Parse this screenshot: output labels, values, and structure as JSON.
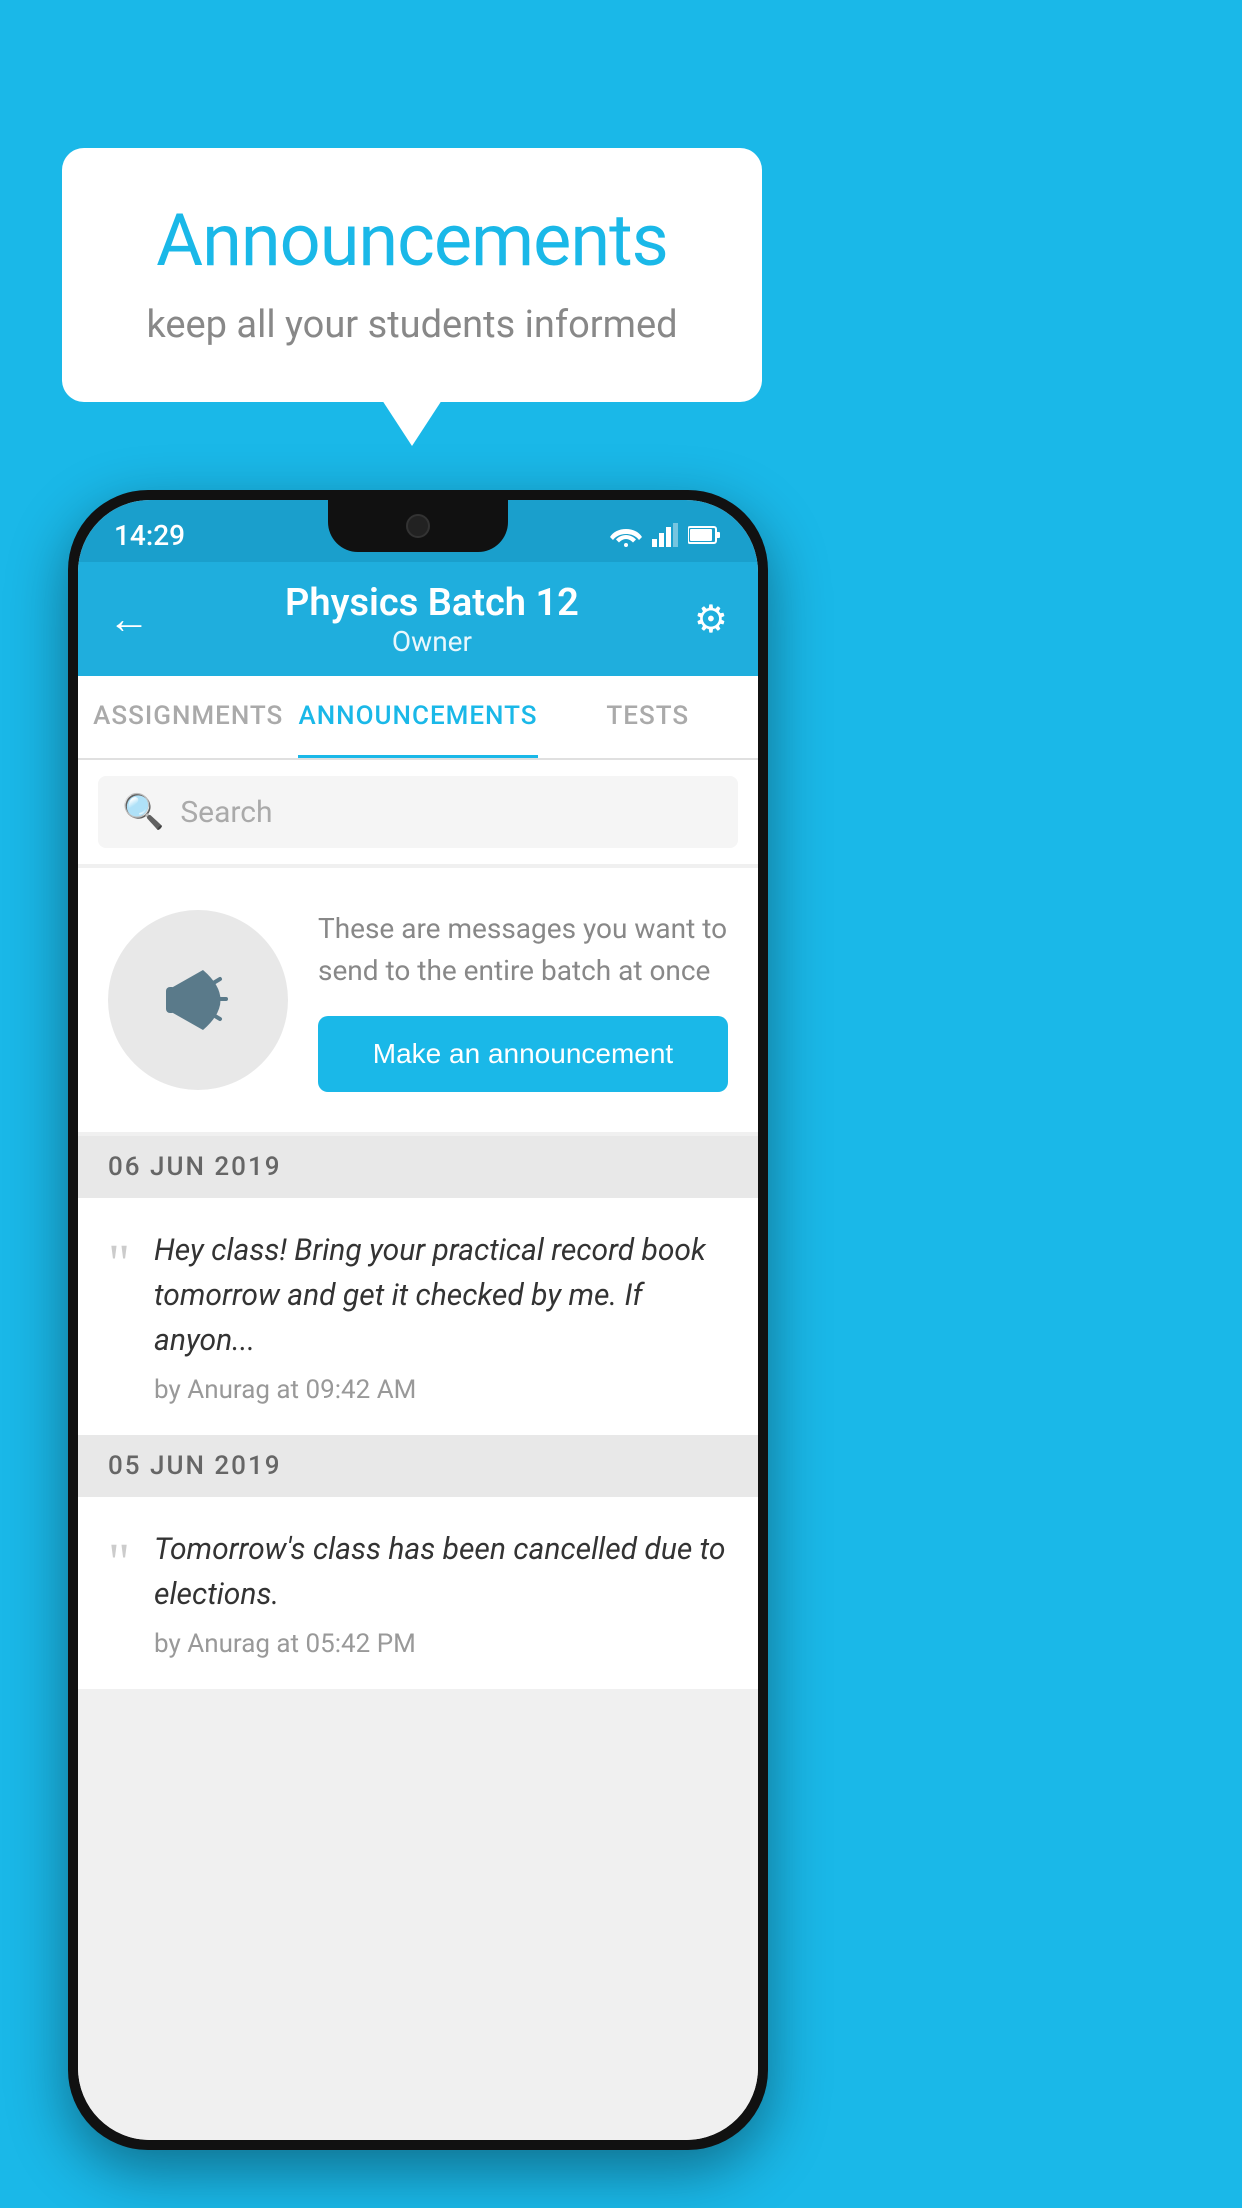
{
  "background_color": "#1ab8e8",
  "speech_bubble": {
    "title": "Announcements",
    "subtitle": "keep all your students informed"
  },
  "phone": {
    "status_bar": {
      "time": "14:29"
    },
    "app_bar": {
      "back_label": "←",
      "title": "Physics Batch 12",
      "subtitle": "Owner",
      "gear_label": "⚙"
    },
    "tabs": [
      {
        "label": "ASSIGNMENTS",
        "active": false
      },
      {
        "label": "ANNOUNCEMENTS",
        "active": true
      },
      {
        "label": "TESTS",
        "active": false
      }
    ],
    "search": {
      "placeholder": "Search"
    },
    "announcement_prompt": {
      "description": "These are messages you want to send to the entire batch at once",
      "button_label": "Make an announcement"
    },
    "announcements": [
      {
        "date": "06  JUN  2019",
        "text": "Hey class! Bring your practical record book tomorrow and get it checked by me. If anyon...",
        "by": "by Anurag at 09:42 AM"
      },
      {
        "date": "05  JUN  2019",
        "text": "Tomorrow's class has been cancelled due to elections.",
        "by": "by Anurag at 05:42 PM"
      }
    ]
  }
}
